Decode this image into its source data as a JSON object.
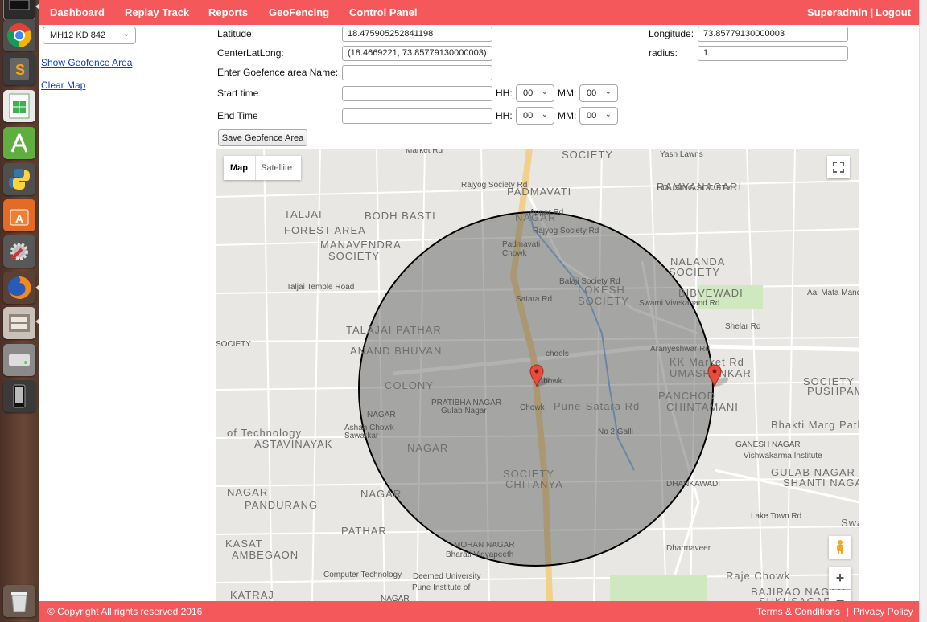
{
  "launcher": {
    "items": [
      "terminal",
      "chrome",
      "sublime-text",
      "spreadsheet",
      "android-studio",
      "python",
      "software-center",
      "system-settings",
      "firefox",
      "file-manager",
      "disk-drive",
      "device",
      "trash"
    ]
  },
  "nav": {
    "items": [
      "Dashboard",
      "Replay Track",
      "Reports",
      "GeoFencing",
      "Control Panel"
    ],
    "user": "Superadmin",
    "separator": "|",
    "logout": "Logout"
  },
  "sidebar": {
    "vehicle": "MH12 KD 842",
    "show_geofence": "Show Geofence Area",
    "clear_map": "Clear Map"
  },
  "form": {
    "latitude_label": "Latitude:",
    "latitude": "18.475905252841198",
    "longitude_label": "Longitude:",
    "longitude": "73.85779130000003",
    "center_label": "CenterLatLong:",
    "center": "(18.4669221, 73.85779130000003)",
    "radius_label": "radius:",
    "radius": "1",
    "name_label": "Enter Goefence area Name:",
    "name": "",
    "start_label": "Start time",
    "end_label": "End Time",
    "start": "",
    "end": "",
    "hh_label": "HH:",
    "mm_label": "MM:",
    "start_hh": "00",
    "start_mm": "00",
    "end_hh": "00",
    "end_mm": "00",
    "save": "Save Geofence Area"
  },
  "map": {
    "type_map": "Map",
    "type_satellite": "Satellite",
    "labels": [
      "SOCIETY",
      "Yash Lawns",
      "RAMYANAGARI",
      "HOUSING SOCIETY",
      "PADMAVATI",
      "NAGAR",
      "TALJAI",
      "FOREST AREA",
      "BODH BASTI",
      "MANAVENDRA",
      "SOCIETY",
      "Padmavati",
      "Chowk",
      "Rajyog Society Rd",
      "Balaji Society Rd",
      "LOKESH",
      "SOCIETY",
      "NALANDA",
      "SOCIETY",
      "BIBVEWADI",
      "Aai Mata Mandir",
      "Taljai Temple Road",
      "Satara Rd",
      "Swami Vivekanand Rd",
      "Shelar Rd",
      "TALAJAI PATHAR",
      "ANAND BHUVAN",
      "SOCIETY",
      "chools",
      "KK Market Rd",
      "UMASHANKAR",
      "SOCIETY",
      "PUSHPAM",
      "COLONY",
      "PRATIBHA NAGAR",
      "Gulab Nagar",
      "Chowk",
      "Pune-Satara Rd",
      "PANCHOD",
      "CHINTAMANI",
      "NAGAR",
      "Ashan Chowk",
      "Sawarkar",
      "Chowk",
      "No 2 Galli",
      "Bhakti Marg Path",
      "GANESH NAGAR",
      "Vishwakarma Institute",
      "of Technology",
      "ASTAVINAYAK",
      "NAGAR",
      "GULAB NAGAR",
      "SHANTI NAGAR",
      "SOCIETY",
      "CHITANYA",
      "NAGAR",
      "PANDURANG",
      "NAGAR",
      "DHANKAWADI",
      "Swami Vivekanand Rd",
      "KASAT",
      "AMBEGAON",
      "PATHAR",
      "MOHAN NAGAR",
      "Bharati Vidyapeeth",
      "Deemed University",
      "Pune Institute of",
      "Computer Technology",
      "Raje Chowk",
      "KATRAJ",
      "BAJIRAO NAGAR",
      "SUKHSAGAR",
      "NAGAR",
      "Dharmaveer",
      "Lake Town Rd",
      "Appar Rd",
      "Rajyog Society Rd",
      "Aranyeshwar Rd",
      "Market Rd",
      "Jbale Path"
    ]
  },
  "footer": {
    "copyright": "© Copyright All rights reserved 2016",
    "terms": "Terms & Conditions",
    "separator": "|",
    "privacy": "Privacy Policy"
  },
  "colors": {
    "brand": "#f5585a",
    "link": "#0a3ed8",
    "geofence_fill": "#555555",
    "marker": "#e84c3d"
  }
}
